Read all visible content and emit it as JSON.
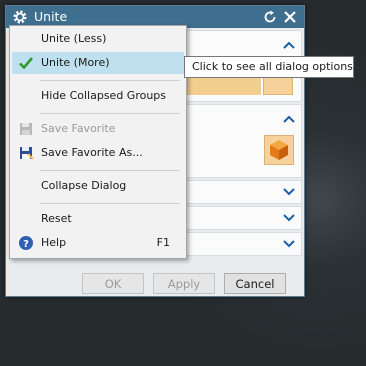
{
  "window": {
    "title": "Unite"
  },
  "buttons": {
    "ok": "OK",
    "apply": "Apply",
    "cancel": "Cancel"
  },
  "menu": {
    "items": [
      {
        "label": "Unite (Less)"
      },
      {
        "label": "Unite (More)"
      },
      {
        "label": "Hide Collapsed Groups"
      },
      {
        "label": "Save Favorite"
      },
      {
        "label": "Save Favorite As..."
      },
      {
        "label": "Collapse Dialog"
      },
      {
        "label": "Reset"
      },
      {
        "label": "Help",
        "shortcut": "F1"
      }
    ]
  },
  "tooltip": {
    "text": "Click to see all dialog options."
  },
  "colors": {
    "titlebar": "#3f6f8e",
    "accent": "#1a5fa8",
    "selection": "#bfe0ee"
  },
  "icons": [
    "gear-icon",
    "reset-icon",
    "close-icon",
    "check-icon",
    "floppy-icon",
    "help-icon",
    "chevron-up-icon",
    "chevron-down-icon",
    "cube-icon"
  ]
}
